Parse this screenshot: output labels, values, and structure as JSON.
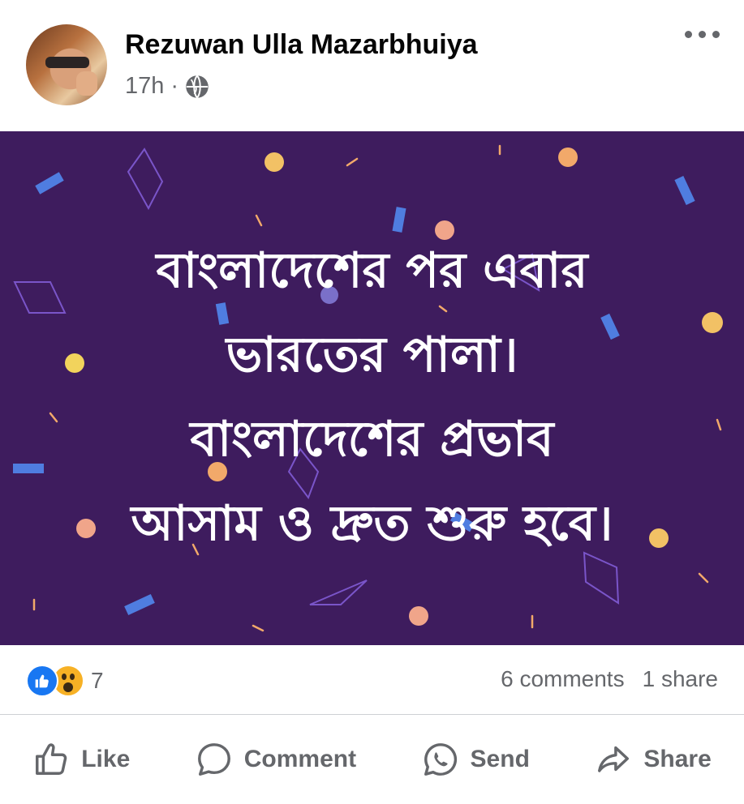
{
  "post": {
    "author": "Rezuwan Ulla Mazarbhuiya",
    "time": "17h",
    "privacy_icon": "globe-icon",
    "image_text": [
      "বাংলাদেশের পর এবার",
      "ভারতের পালা।",
      "বাংলাদেশের প্রভাব",
      "আসাম ও দ্রুত শুরু হবে।"
    ],
    "image_background": "#3e1c5e"
  },
  "stats": {
    "reactions": [
      "like",
      "wow"
    ],
    "reaction_count": "7",
    "comments": "6 comments",
    "shares": "1 share"
  },
  "actions": {
    "like": "Like",
    "comment": "Comment",
    "send": "Send",
    "share": "Share"
  },
  "colors": {
    "brand_blue": "#1877f2",
    "muted_text": "#65676b",
    "wow_yellow": "#f7b125"
  }
}
